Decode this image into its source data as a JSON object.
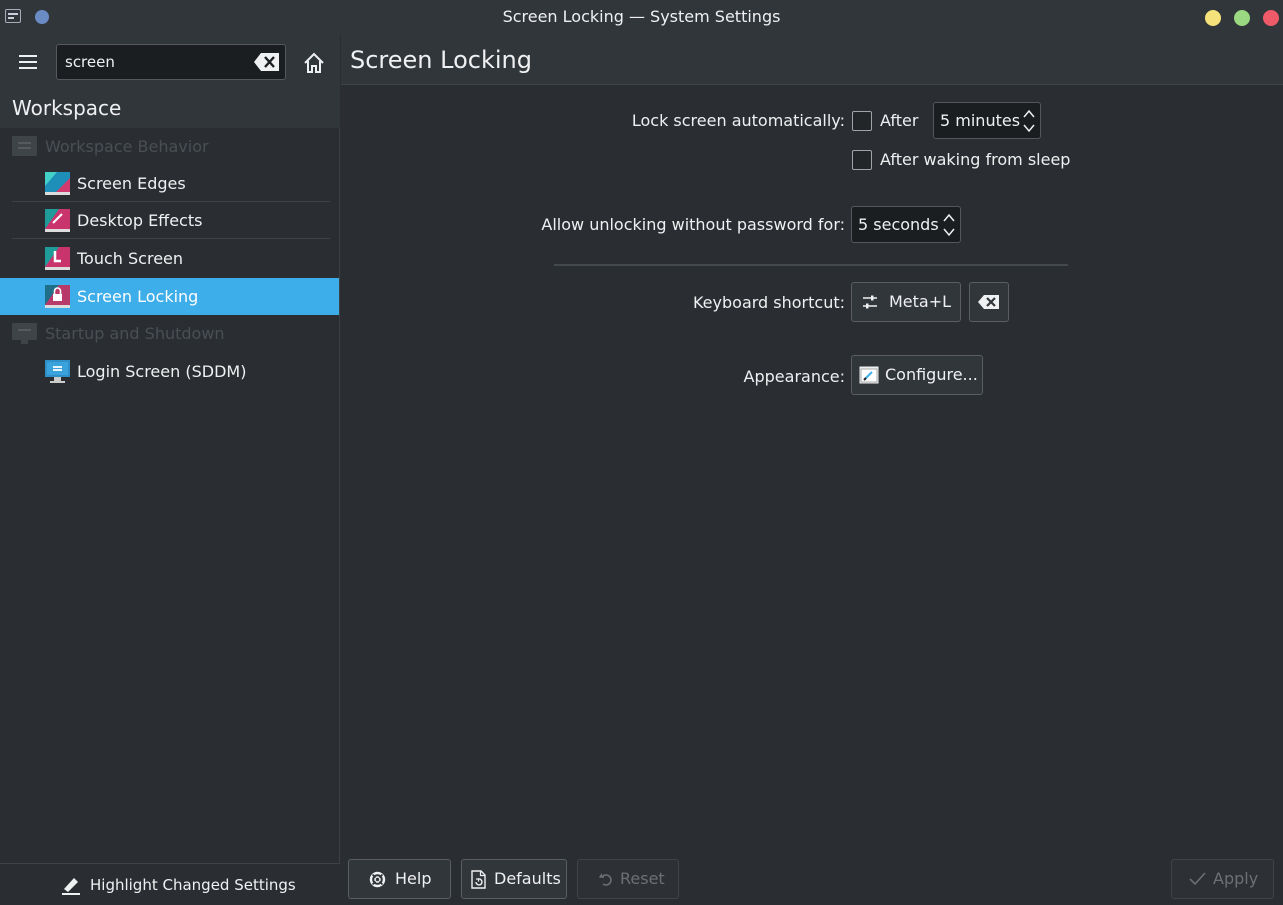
{
  "window": {
    "title": "Screen Locking — System Settings"
  },
  "search": {
    "value": "screen"
  },
  "sidebar": {
    "category": "Workspace",
    "items": [
      {
        "label": "Workspace Behavior",
        "kind": "header"
      },
      {
        "label": "Screen Edges"
      },
      {
        "label": "Desktop Effects"
      },
      {
        "label": "Touch Screen"
      },
      {
        "label": "Screen Locking",
        "selected": true
      },
      {
        "label": "Startup and Shutdown",
        "kind": "header"
      },
      {
        "label": "Login Screen (SDDM)"
      }
    ],
    "highlight_label": "Highlight Changed Settings"
  },
  "page": {
    "title": "Screen Locking",
    "lock_auto_label": "Lock screen automatically:",
    "after_label": "After",
    "after_value": "5 minutes",
    "after_waking_label": "After waking from sleep",
    "unlock_label": "Allow unlocking without password for:",
    "unlock_value": "5 seconds",
    "shortcut_label": "Keyboard shortcut:",
    "shortcut_value": "Meta+L",
    "appearance_label": "Appearance:",
    "configure_label": "Configure..."
  },
  "footer": {
    "help": "Help",
    "defaults": "Defaults",
    "reset": "Reset",
    "apply": "Apply"
  },
  "colors": {
    "accent": "#3daee9",
    "window_bg": "#2a2e32",
    "header_bg": "#31363b"
  }
}
